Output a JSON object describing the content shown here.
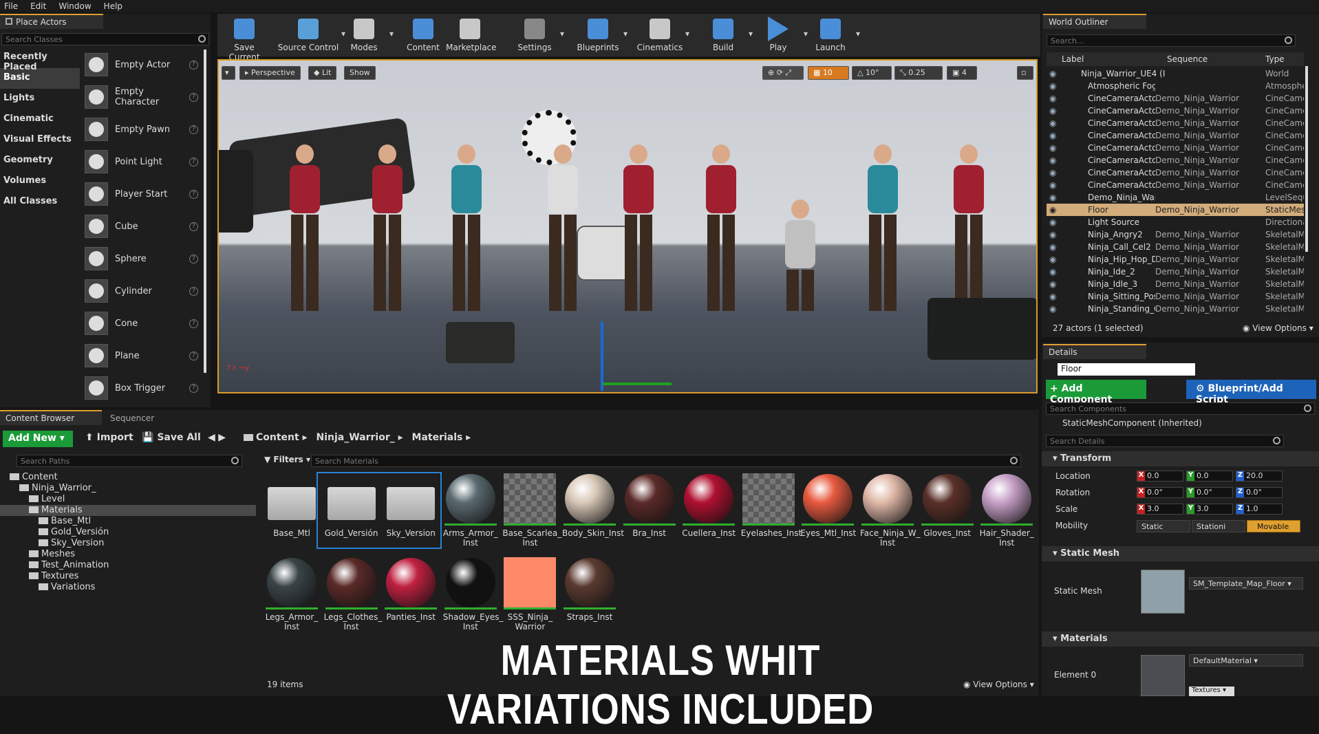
{
  "menu": [
    "File",
    "Edit",
    "Window",
    "Help"
  ],
  "place_actors": {
    "tab": "Place Actors",
    "search_placeholder": "Search Classes",
    "categories": [
      "Recently Placed",
      "Basic",
      "Lights",
      "Cinematic",
      "Visual Effects",
      "Geometry",
      "Volumes",
      "All Classes"
    ],
    "selected_category": "Basic",
    "actors": [
      "Empty Actor",
      "Empty Character",
      "Empty Pawn",
      "Point Light",
      "Player Start",
      "Cube",
      "Sphere",
      "Cylinder",
      "Cone",
      "Plane",
      "Box Trigger"
    ]
  },
  "toolbar": [
    {
      "label": "Save Current",
      "icon": "save-icon"
    },
    {
      "label": "Source Control",
      "icon": "source-control-icon"
    },
    {
      "label": "Modes",
      "icon": "modes-icon"
    },
    {
      "label": "Content",
      "icon": "content-icon"
    },
    {
      "label": "Marketplace",
      "icon": "marketplace-icon"
    },
    {
      "label": "Settings",
      "icon": "settings-icon"
    },
    {
      "label": "Blueprints",
      "icon": "blueprints-icon"
    },
    {
      "label": "Cinematics",
      "icon": "cinematics-icon"
    },
    {
      "label": "Build",
      "icon": "build-icon"
    },
    {
      "label": "Play",
      "icon": "play-icon"
    },
    {
      "label": "Launch",
      "icon": "launch-icon"
    }
  ],
  "viewport": {
    "perspective": "Perspective",
    "lit": "Lit",
    "show": "Show",
    "grid_snap": "10",
    "rot_snap": "10°",
    "scale_snap": "0.25",
    "cam_speed": "4"
  },
  "outliner": {
    "tab": "World Outliner",
    "search_placeholder": "Search...",
    "columns": [
      "Label",
      "Sequence",
      "Type"
    ],
    "rows": [
      {
        "label": "Ninja_Warrior_UE4 (I",
        "seq": "",
        "type": "World",
        "root": true
      },
      {
        "label": "Atmospheric Fog",
        "seq": "",
        "type": "Atmospher"
      },
      {
        "label": "CineCameraActor",
        "seq": "Demo_Ninja_Warrior",
        "type": "CineCamer"
      },
      {
        "label": "CineCameraActor",
        "seq": "Demo_Ninja_Warrior",
        "type": "CineCamer"
      },
      {
        "label": "CineCameraActor",
        "seq": "Demo_Ninja_Warrior",
        "type": "CineCamer"
      },
      {
        "label": "CineCameraActor",
        "seq": "Demo_Ninja_Warrior",
        "type": "CineCamer"
      },
      {
        "label": "CineCameraActor",
        "seq": "Demo_Ninja_Warrior",
        "type": "CineCamer"
      },
      {
        "label": "CineCameraActor",
        "seq": "Demo_Ninja_Warrior",
        "type": "CineCamer"
      },
      {
        "label": "CineCameraActor",
        "seq": "Demo_Ninja_Warrior",
        "type": "CineCamer"
      },
      {
        "label": "CineCameraActor",
        "seq": "Demo_Ninja_Warrior",
        "type": "CineCamer"
      },
      {
        "label": "Demo_Ninja_Warri",
        "seq": "",
        "type": "LevelSeque"
      },
      {
        "label": "Floor",
        "seq": "Demo_Ninja_Warrior",
        "type": "StaticMesh",
        "selected": true
      },
      {
        "label": "Light Source",
        "seq": "",
        "type": "Directional"
      },
      {
        "label": "Ninja_Angry2",
        "seq": "Demo_Ninja_Warrior",
        "type": "SkeletalMe"
      },
      {
        "label": "Ninja_Call_Cel2",
        "seq": "Demo_Ninja_Warrior",
        "type": "SkeletalMe"
      },
      {
        "label": "Ninja_Hip_Hop_Da",
        "seq": "Demo_Ninja_Warrior",
        "type": "SkeletalMe"
      },
      {
        "label": "Ninja_Ide_2",
        "seq": "Demo_Ninja_Warrior",
        "type": "SkeletalMe"
      },
      {
        "label": "Ninja_Idle_3",
        "seq": "Demo_Ninja_Warrior",
        "type": "SkeletalMe"
      },
      {
        "label": "Ninja_Sitting_Pos",
        "seq": "Demo_Ninja_Warrior",
        "type": "SkeletalMe"
      },
      {
        "label": "Ninja_Standing_G",
        "seq": "Demo_Ninja_Warrior",
        "type": "SkeletalMe"
      }
    ],
    "status": "27 actors (1 selected)",
    "view_options": "View Options"
  },
  "details": {
    "tab": "Details",
    "name": "Floor",
    "add_component": "+ Add Component",
    "blueprint": "Blueprint/Add Script",
    "search_components": "Search Components",
    "component": "StaticMeshComponent (Inherited)",
    "search_details": "Search Details",
    "transform_header": "Transform",
    "location_label": "Location",
    "rotation_label": "Rotation",
    "scale_label": "Scale",
    "mobility_label": "Mobility",
    "location": [
      "0.0",
      "0.0",
      "20.0"
    ],
    "rotation": [
      "0.0°",
      "0.0°",
      "0.0°"
    ],
    "scale": [
      "3.0",
      "3.0",
      "1.0"
    ],
    "mobility": [
      "Static",
      "Stationi",
      "Movable"
    ],
    "static_mesh_header": "Static Mesh",
    "static_mesh_label": "Static Mesh",
    "static_mesh_value": "SM_Template_Map_Floor",
    "materials_header": "Materials",
    "element0_label": "Element 0",
    "element0_value": "DefaultMaterial",
    "textures": "Textures"
  },
  "content_browser": {
    "tab": "Content Browser",
    "tab2": "Sequencer",
    "add_new": "Add New",
    "import": "Import",
    "save_all": "Save All",
    "breadcrumb": [
      "Content",
      "Ninja_Warrior_",
      "Materials"
    ],
    "search_paths": "Search Paths",
    "filters": "Filters",
    "search_materials": "Search Materials",
    "tree": [
      {
        "label": "Content",
        "depth": 0
      },
      {
        "label": "Ninja_Warrior_",
        "depth": 1
      },
      {
        "label": "Level",
        "depth": 2
      },
      {
        "label": "Materials",
        "depth": 2,
        "selected": true
      },
      {
        "label": "Base_Mtl",
        "depth": 3
      },
      {
        "label": "Gold_Versión",
        "depth": 3
      },
      {
        "label": "Sky_Version",
        "depth": 3
      },
      {
        "label": "Meshes",
        "depth": 2
      },
      {
        "label": "Test_Animation",
        "depth": 2
      },
      {
        "label": "Textures",
        "depth": 2
      },
      {
        "label": "Variations",
        "depth": 3
      }
    ],
    "assets": [
      {
        "name": "Base_Mtl",
        "kind": "folder"
      },
      {
        "name": "Gold_Versión",
        "kind": "folder"
      },
      {
        "name": "Sky_Version",
        "kind": "folder"
      },
      {
        "name": "Arms_Armor_ Inst",
        "kind": "sphere",
        "color": "#5a6a70"
      },
      {
        "name": "Base_Scarlea_ Inst",
        "kind": "checker",
        "color": "#888"
      },
      {
        "name": "Body_Skin_Inst",
        "kind": "sphere",
        "color": "#d8c8b8"
      },
      {
        "name": "Bra_Inst",
        "kind": "sphere",
        "color": "#5a2a28"
      },
      {
        "name": "Cuellera_Inst",
        "kind": "sphere",
        "color": "#b01030"
      },
      {
        "name": "Eyelashes_Inst",
        "kind": "checker",
        "color": "#777"
      },
      {
        "name": "Eyes_Mtl_Inst",
        "kind": "sphere",
        "color": "#e85a40"
      },
      {
        "name": "Face_Ninja_W_ Inst",
        "kind": "sphere",
        "color": "#e0b8a8"
      },
      {
        "name": "Gloves_Inst",
        "kind": "sphere",
        "color": "#5a3028"
      },
      {
        "name": "Hair_Shader_ Inst",
        "kind": "sphere",
        "color": "#c8a0c8"
      },
      {
        "name": "Legs_Armor_ Inst",
        "kind": "sphere",
        "color": "#3a4448"
      },
      {
        "name": "Legs_Clothes_ Inst",
        "kind": "sphere",
        "color": "#5a2a28"
      },
      {
        "name": "Panties_Inst",
        "kind": "sphere",
        "color": "#c02040"
      },
      {
        "name": "Shadow_Eyes_ Inst",
        "kind": "sphere",
        "color": "#111"
      },
      {
        "name": "SSS_Ninja_ Warrior",
        "kind": "swatch",
        "color": "#ff8a6a"
      },
      {
        "name": "Straps_Inst",
        "kind": "sphere",
        "color": "#5a3a30"
      }
    ],
    "item_count": "19 items",
    "view_options": "View Options"
  },
  "overlay_caption": "MATERIALS WHIT VARIATIONS INCLUDED"
}
